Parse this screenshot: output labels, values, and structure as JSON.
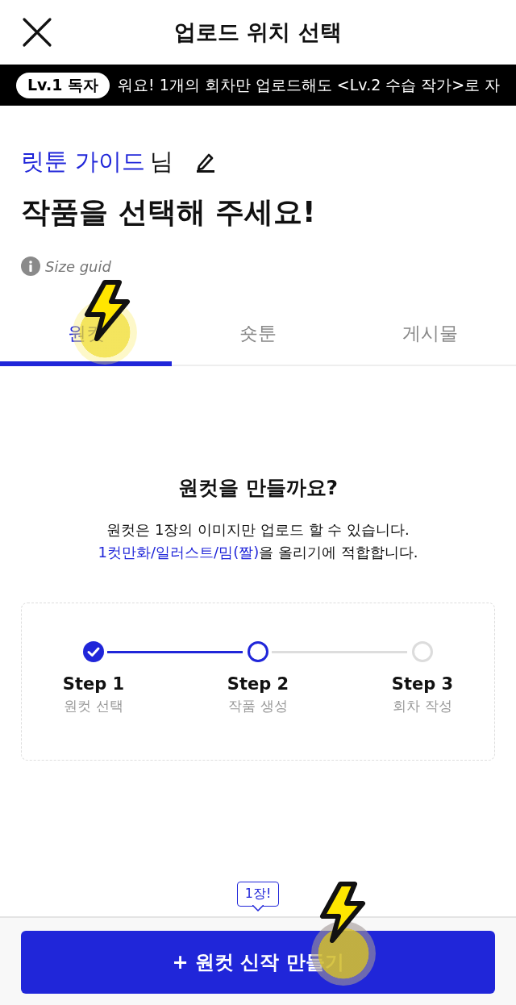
{
  "header": {
    "title": "업로드 위치 선택"
  },
  "banner": {
    "badge": "Lv.1 독자",
    "message": "워요! 1개의 회차만 업로드해도 <Lv.2 수습 작가>로 자"
  },
  "greeting": {
    "name": "릿툰 가이드",
    "suffix": "님"
  },
  "headline": "작품을 선택해 주세요!",
  "size_guide": "Size guid",
  "tabs": [
    {
      "label": "원컷",
      "selected": true
    },
    {
      "label": "숏툰",
      "selected": false
    },
    {
      "label": "게시물",
      "selected": false
    }
  ],
  "intro": {
    "title": "원컷을 만들까요?",
    "line_1": "원컷은 1장의 이미지만 업로드 할 수 있습니다.",
    "link": "1컷만화/일러스트/밈(짤)",
    "line_2_rest": "을 올리기에 적합합니다."
  },
  "steps": [
    {
      "label": "Step 1",
      "caption": "원컷 선택",
      "kind": "done"
    },
    {
      "label": "Step 2",
      "caption": "작품 생성",
      "kind": "current"
    },
    {
      "label": "Step 3",
      "caption": "회차 작성",
      "kind": "pending"
    }
  ],
  "tooltip": "1장!",
  "create_button": "+ 원컷 신작 만들기"
}
